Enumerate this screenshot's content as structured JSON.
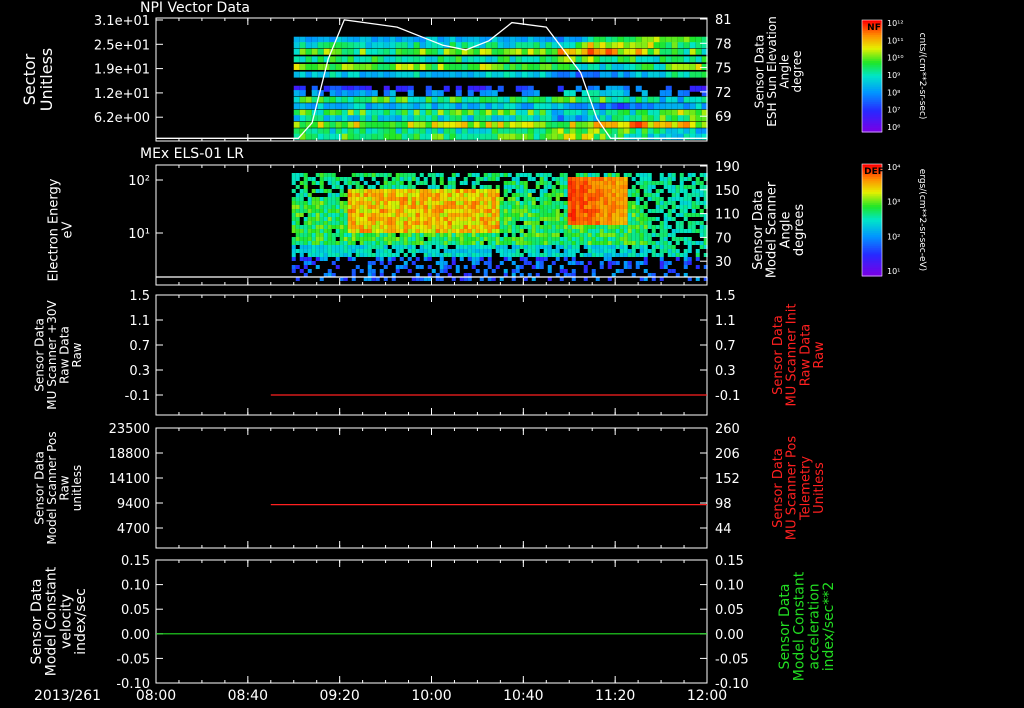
{
  "colors": {
    "white": "#ffffff",
    "red": "#ff2020",
    "green": "#22dd22",
    "black": "#000000"
  },
  "x_axis": {
    "date": "2013/261",
    "ticks": [
      "08:00",
      "08:40",
      "09:20",
      "10:00",
      "10:40",
      "11:20",
      "12:00"
    ]
  },
  "chart_data": [
    {
      "type": "heatmap",
      "title": "NPI Vector Data",
      "ylabel": [
        "Sector",
        "Unitless"
      ],
      "yticks": [
        "3.1e+01",
        "2.5e+01",
        "1.9e+01",
        "1.2e+01",
        "6.2e+00"
      ],
      "data_start": "09:00",
      "overlay": {
        "ylabel": [
          "Sensor Data",
          "ESH Sun Elevation",
          "Angle",
          "degree"
        ],
        "yticks": [
          "81",
          "78",
          "75",
          "72",
          "69"
        ],
        "ylim": [
          67.5,
          81
        ],
        "x": [
          "08:00",
          "09:02",
          "09:08",
          "09:15",
          "09:22",
          "09:45",
          "10:05",
          "10:15",
          "10:25",
          "10:35",
          "10:50",
          "11:05",
          "11:12",
          "11:18",
          "12:00"
        ],
        "y": [
          67.8,
          67.8,
          69.5,
          76.5,
          80.8,
          80,
          78,
          77.5,
          78.5,
          80.5,
          80,
          75,
          70,
          67.8,
          67.8
        ]
      },
      "colorbar": {
        "label": "NF",
        "units": "cnts/(cm**2-sr-sec)",
        "ticks": [
          "10¹²",
          "10¹¹",
          "10¹⁰",
          "10⁹",
          "10⁸",
          "10⁷",
          "10⁶"
        ]
      }
    },
    {
      "type": "heatmap",
      "title": "MEx ELS-01 LR",
      "ylabel": [
        "Electron Energy",
        "eV"
      ],
      "yticks": [
        "10²",
        "10¹"
      ],
      "data_start": "09:00",
      "overlay": {
        "ylabel": [
          "Sensor Data",
          "Model Scanner",
          "Angle",
          "degrees"
        ],
        "yticks": [
          "190",
          "150",
          "110",
          "70",
          "30"
        ],
        "value": 10
      },
      "colorbar": {
        "label": "DEF",
        "units": "ergs/(cm**2-sr-sec-eV)",
        "ticks": [
          "10⁴",
          "10³",
          "10²",
          "10¹"
        ]
      }
    },
    {
      "type": "line",
      "ylabel": [
        "Sensor Data",
        "MU Scanner +30V",
        "Raw Data",
        "Raw"
      ],
      "yticks_left": [
        "1.5",
        "1.1",
        "0.7",
        "0.3",
        "-0.1"
      ],
      "ylim_left": [
        -0.3,
        1.5
      ],
      "right_label": [
        "Sensor Data",
        "MU Scanner Init",
        "Raw Data",
        "Raw"
      ],
      "yticks_right": [
        "1.5",
        "1.1",
        "0.7",
        "0.3",
        "-0.1"
      ],
      "series": [
        {
          "x": [
            "08:50",
            "12:00"
          ],
          "y": [
            0.0,
            0.0
          ]
        }
      ]
    },
    {
      "type": "line",
      "ylabel": [
        "Sensor Data",
        "Model Scanner Pos",
        "Raw",
        "unitless"
      ],
      "yticks_left": [
        "23500",
        "18800",
        "14100",
        "9400",
        "4700"
      ],
      "ylim_left": [
        0,
        23500
      ],
      "right_label": [
        "Sensor Data",
        "MU Scanner Pos",
        "Telemetry",
        "Unitless"
      ],
      "yticks_right": [
        "260",
        "206",
        "152",
        "98",
        "44"
      ],
      "series": [
        {
          "x": [
            "08:50",
            "12:00"
          ],
          "y": [
            8500,
            8500
          ]
        }
      ]
    },
    {
      "type": "line",
      "ylabel": [
        "Sensor Data",
        "Model Constant",
        "velocity",
        "index/sec"
      ],
      "yticks_left": [
        "0.15",
        "0.10",
        "0.05",
        "0.00",
        "-0.05",
        "-0.10"
      ],
      "ylim_left": [
        -0.1,
        0.15
      ],
      "right_label": [
        "Sensor Data",
        "Model Constant",
        "acceleration",
        "index/sec**2"
      ],
      "yticks_right": [
        "0.15",
        "0.10",
        "0.05",
        "0.00",
        "-0.05",
        "-0.10"
      ],
      "series": [
        {
          "x": [
            "08:00",
            "12:00"
          ],
          "y": [
            0.0,
            0.0
          ]
        }
      ]
    }
  ]
}
